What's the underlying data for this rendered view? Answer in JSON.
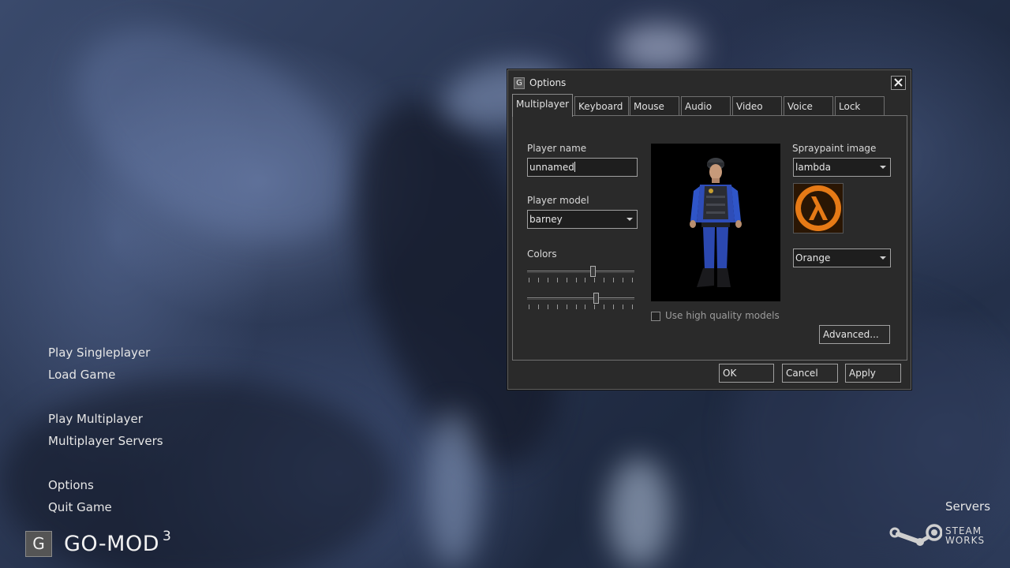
{
  "main_menu": {
    "items": [
      {
        "label": "Play Singleplayer"
      },
      {
        "label": "Load Game"
      },
      {
        "label": "Play Multiplayer"
      },
      {
        "label": "Multiplayer Servers"
      },
      {
        "label": "Options"
      },
      {
        "label": "Quit Game"
      }
    ],
    "logo_letter": "G",
    "logo_text": "GO-MOD",
    "logo_version": "3",
    "servers_label": "Servers",
    "steamworks": {
      "line1": "STEAM",
      "line2": "WORKS"
    }
  },
  "dialog": {
    "icon_letter": "G",
    "title": "Options",
    "tabs": [
      {
        "label": "Multiplayer",
        "active": true
      },
      {
        "label": "Keyboard"
      },
      {
        "label": "Mouse"
      },
      {
        "label": "Audio"
      },
      {
        "label": "Video"
      },
      {
        "label": "Voice"
      },
      {
        "label": "Lock"
      }
    ],
    "multiplayer": {
      "player_name_label": "Player name",
      "player_name_value": "unnamed",
      "player_model_label": "Player model",
      "player_model_value": "barney",
      "colors_label": "Colors",
      "color_sliders": [
        0.62,
        0.65
      ],
      "spray_label": "Spraypaint image",
      "spray_value": "lambda",
      "spray_color_value": "Orange",
      "spray_icon": "lambda-logo-icon",
      "hq_models_label": "Use high quality models",
      "hq_models_checked": false,
      "advanced_label": "Advanced..."
    },
    "buttons": {
      "ok": "OK",
      "cancel": "Cancel",
      "apply": "Apply"
    }
  },
  "colors": {
    "spray_orange": "#e67a16",
    "dialog_bg": "#2a2a2a"
  }
}
